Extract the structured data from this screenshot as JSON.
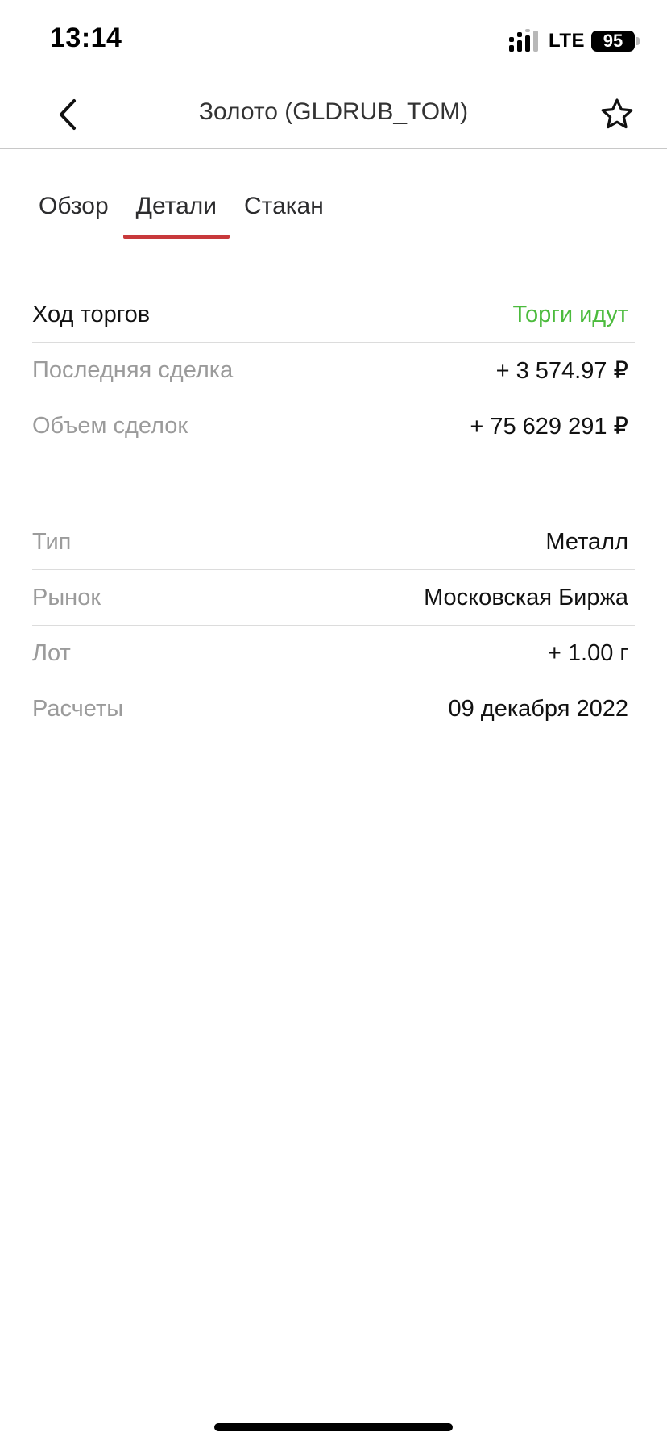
{
  "status_bar": {
    "time": "13:14",
    "network": "LTE",
    "battery": "95",
    "icons": [
      "signal-icon",
      "battery-icon"
    ]
  },
  "nav": {
    "title": "Золото (GLDRUB_TOM)",
    "icons": [
      "back-chevron-icon",
      "star-icon"
    ]
  },
  "tabs": [
    {
      "label": "Обзор",
      "active": false
    },
    {
      "label": "Детали",
      "active": true
    },
    {
      "label": "Стакан",
      "active": false
    }
  ],
  "trading": {
    "status_label": "Ход торгов",
    "status_value": "Торги идут",
    "last_trade_label": "Последняя сделка",
    "last_trade_value": "+ 3 574.97 ₽",
    "volume_label": "Объем сделок",
    "volume_value": "+ 75 629 291 ₽"
  },
  "info": {
    "type_label": "Тип",
    "type_value": "Металл",
    "market_label": "Рынок",
    "market_value": "Московская Биржа",
    "lot_label": "Лот",
    "lot_value": "+ 1.00 г",
    "settlement_label": "Расчеты",
    "settlement_value": "09 декабря 2022"
  },
  "colors": {
    "accent_tab": "#c8393b",
    "positive": "#4cbb3d",
    "muted_label": "#9b9b9b"
  }
}
